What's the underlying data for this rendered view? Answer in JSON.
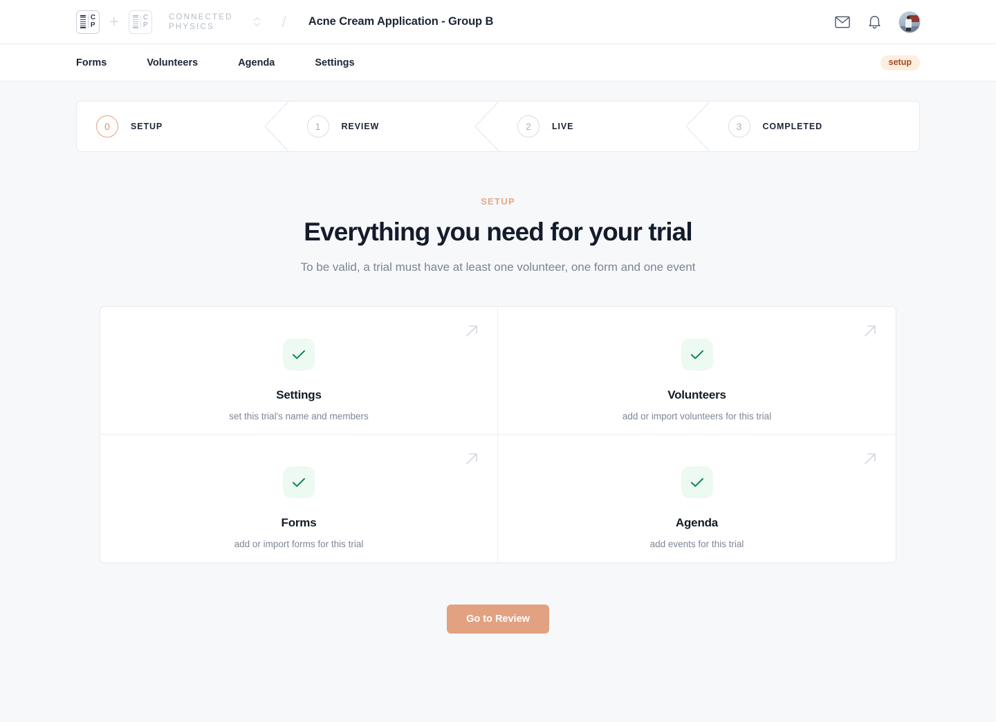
{
  "header": {
    "primary_logo": {
      "letters": [
        "C",
        "P"
      ],
      "icon": "connected-physics-mark"
    },
    "plus": "+",
    "org_logo": {
      "letters": [
        "C",
        "P"
      ]
    },
    "org_name_line1": "CONNECTED",
    "org_name_line2": "PHYSICS",
    "separator": "/",
    "trial_title": "Acne Cream Application - Group B",
    "icons": {
      "mail": "mail-icon",
      "bell": "bell-icon",
      "avatar": "user-avatar"
    }
  },
  "nav": {
    "items": [
      {
        "label": "Forms"
      },
      {
        "label": "Volunteers"
      },
      {
        "label": "Agenda"
      },
      {
        "label": "Settings"
      }
    ],
    "status_badge": "setup",
    "status_badge_bg": "#fdeede",
    "status_badge_color": "#9e4a21"
  },
  "stepper": {
    "steps": [
      {
        "number": "0",
        "label": "SETUP",
        "active": true
      },
      {
        "number": "1",
        "label": "REVIEW",
        "active": false
      },
      {
        "number": "2",
        "label": "LIVE",
        "active": false
      },
      {
        "number": "3",
        "label": "COMPLETED",
        "active": false
      }
    ],
    "active_color": "#e1a07c",
    "inactive_color": "#aab1bd"
  },
  "hero": {
    "eyebrow": "SETUP",
    "eyebrow_color": "#eaa683",
    "title": "Everything you need for your trial",
    "subtitle": "To be valid, a trial must have at least one volunteer, one form and one event"
  },
  "cards": [
    {
      "title": "Settings",
      "desc": "set this trial's name and members",
      "status": "complete"
    },
    {
      "title": "Volunteers",
      "desc": "add or import volunteers for this trial",
      "status": "complete"
    },
    {
      "title": "Forms",
      "desc": "add or import forms for this trial",
      "status": "complete"
    },
    {
      "title": "Agenda",
      "desc": "add events for this trial",
      "status": "complete"
    }
  ],
  "card_style": {
    "check_bg": "#ecfaf1",
    "check_color": "#12815c"
  },
  "cta": {
    "label": "Go to Review",
    "bg": "#e2a181",
    "color": "#ffffff"
  }
}
